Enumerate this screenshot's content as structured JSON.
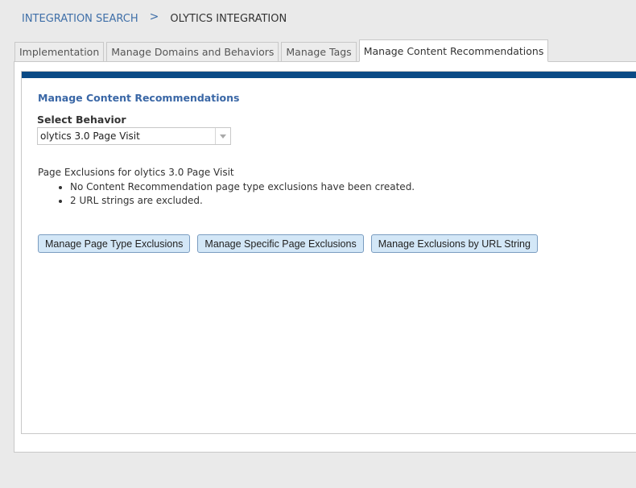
{
  "breadcrumb": {
    "link_label": "INTEGRATION SEARCH",
    "separator": ">",
    "current_label": "OLYTICS INTEGRATION"
  },
  "tabs": [
    {
      "label": "Implementation",
      "active": false
    },
    {
      "label": "Manage Domains and Behaviors",
      "active": false
    },
    {
      "label": "Manage Tags",
      "active": false
    },
    {
      "label": "Manage Content Recommendations",
      "active": true
    }
  ],
  "main": {
    "section_title": "Manage Content Recommendations",
    "select_label": "Select Behavior",
    "select_value": "olytics 3.0 Page Visit",
    "exclusions_heading": "Page Exclusions for olytics 3.0 Page Visit",
    "exclusions": [
      "No Content Recommendation page type exclusions have been created.",
      "2 URL strings are excluded."
    ],
    "buttons": {
      "page_type": "Manage Page Type Exclusions",
      "specific_page": "Manage Specific Page Exclusions",
      "url_string": "Manage Exclusions by URL String"
    }
  },
  "colors": {
    "accent_bar": "#0a4a85",
    "link": "#3f6fa8",
    "title": "#3a67a6",
    "button_bg": "#d3e7f7"
  },
  "icons": {
    "select_arrow": "chevron-down-icon"
  }
}
